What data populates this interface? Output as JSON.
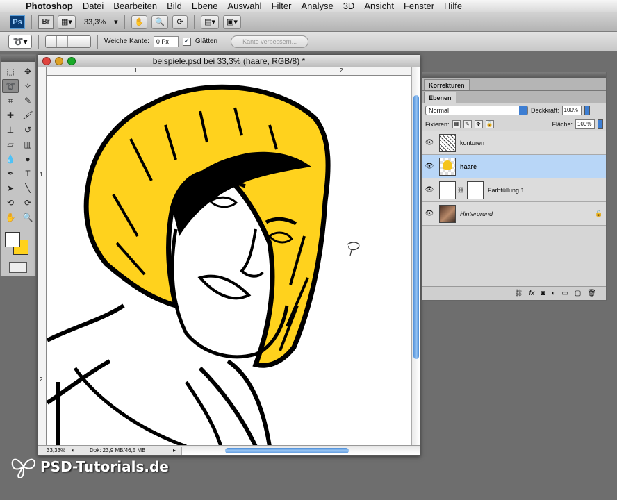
{
  "menubar": {
    "items": [
      "Photoshop",
      "Datei",
      "Bearbeiten",
      "Bild",
      "Ebene",
      "Auswahl",
      "Filter",
      "Analyse",
      "3D",
      "Ansicht",
      "Fenster",
      "Hilfe"
    ]
  },
  "appbar": {
    "ps_label": "Ps",
    "br_label": "Br",
    "zoom": "33,3%"
  },
  "options": {
    "feather_label": "Weiche Kante:",
    "feather_value": "0 Px",
    "antialias_label": "Glätten",
    "antialias_checked": true,
    "refine_edge": "Kante verbessern..."
  },
  "tools": {
    "foreground_color": "#ffffff",
    "background_color": "#ffd21d",
    "items": [
      "marquee-icon",
      "move-icon",
      "lasso-icon",
      "magic-wand-icon",
      "crop-icon",
      "eyedropper-icon",
      "healing-icon",
      "brush-icon",
      "clone-stamp-icon",
      "history-brush-icon",
      "eraser-icon",
      "gradient-icon",
      "blur-icon",
      "dodge-icon",
      "pen-icon",
      "type-icon",
      "path-selection-icon",
      "line-icon",
      "3d-rotate-icon",
      "3d-orbit-icon",
      "hand-icon",
      "zoom-icon"
    ]
  },
  "document": {
    "title": "beispiele.psd bei 33,3% (haare, RGB/8) *",
    "ruler_h": [
      "1",
      "2"
    ],
    "ruler_v": [
      "1",
      "2"
    ],
    "status_zoom": "33,33%",
    "status_doc": "Dok: 23,9 MB/46,5 MB"
  },
  "panel": {
    "tab_adjust": "Korrekturen",
    "tab_layers": "Ebenen",
    "blend_mode": "Normal",
    "opacity_label": "Deckkraft:",
    "opacity": "100%",
    "lock_label": "Fixieren:",
    "fill_label": "Fläche:",
    "fill": "100%",
    "layers": [
      {
        "name": "konturen",
        "selected": false
      },
      {
        "name": "haare",
        "selected": true
      },
      {
        "name": "Farbfüllung 1",
        "selected": false
      },
      {
        "name": "Hintergrund",
        "selected": false,
        "locked": true
      }
    ]
  },
  "watermark": {
    "text": "PSD-Tutorials.de"
  },
  "colors": {
    "hair": "#ffd21d",
    "selection": "#b8d6f7",
    "scroll_accent": "#4e8fd9"
  }
}
